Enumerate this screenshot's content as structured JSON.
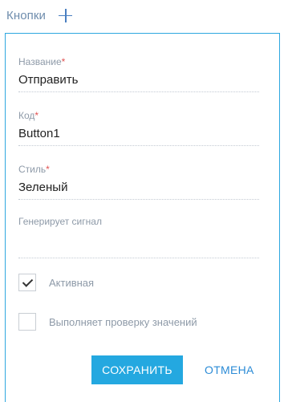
{
  "header": {
    "title": "Кнопки",
    "add_icon": "plus-icon"
  },
  "form": {
    "name": {
      "label": "Название",
      "required_mark": "*",
      "value": "Отправить"
    },
    "code": {
      "label": "Код",
      "required_mark": "*",
      "value": "Button1"
    },
    "style": {
      "label": "Стиль",
      "required_mark": "*",
      "value": "Зеленый"
    },
    "signal": {
      "label": "Генерирует сигнал",
      "value": ""
    },
    "active": {
      "label": "Активная",
      "checked": true
    },
    "validate": {
      "label": "Выполняет проверку значений",
      "checked": false
    }
  },
  "actions": {
    "save_label": "СОХРАНИТЬ",
    "cancel_label": "ОТМЕНА"
  },
  "colors": {
    "accent": "#24a8e0",
    "link": "#2b8bd6",
    "panel_border": "#2ea7e0",
    "required": "#e05252"
  }
}
